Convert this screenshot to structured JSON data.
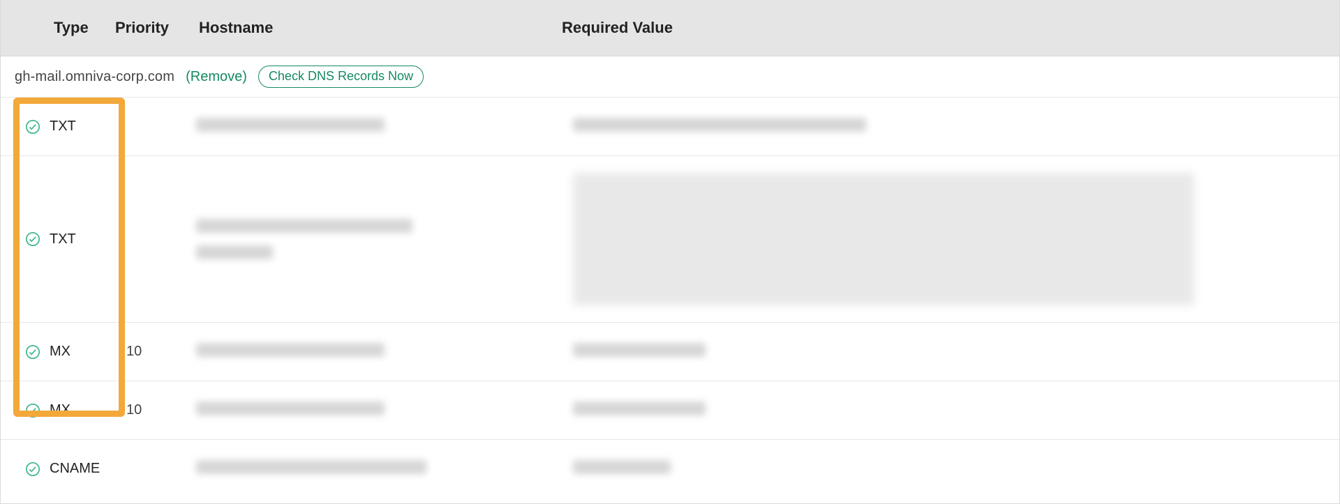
{
  "table": {
    "headers": {
      "type": "Type",
      "priority": "Priority",
      "hostname": "Hostname",
      "value": "Required Value"
    }
  },
  "domain": {
    "name": "gh-mail.omniva-corp.com",
    "remove_label": "(Remove)",
    "check_label": "Check DNS Records Now"
  },
  "rows": [
    {
      "type": "TXT",
      "priority": "",
      "status": "verified"
    },
    {
      "type": "TXT",
      "priority": "",
      "status": "verified"
    },
    {
      "type": "MX",
      "priority": "10",
      "status": "verified"
    },
    {
      "type": "MX",
      "priority": "10",
      "status": "verified"
    },
    {
      "type": "CNAME",
      "priority": "",
      "status": "verified"
    }
  ],
  "colors": {
    "accent_green": "#158a60",
    "highlight_orange": "#f3a83a"
  }
}
